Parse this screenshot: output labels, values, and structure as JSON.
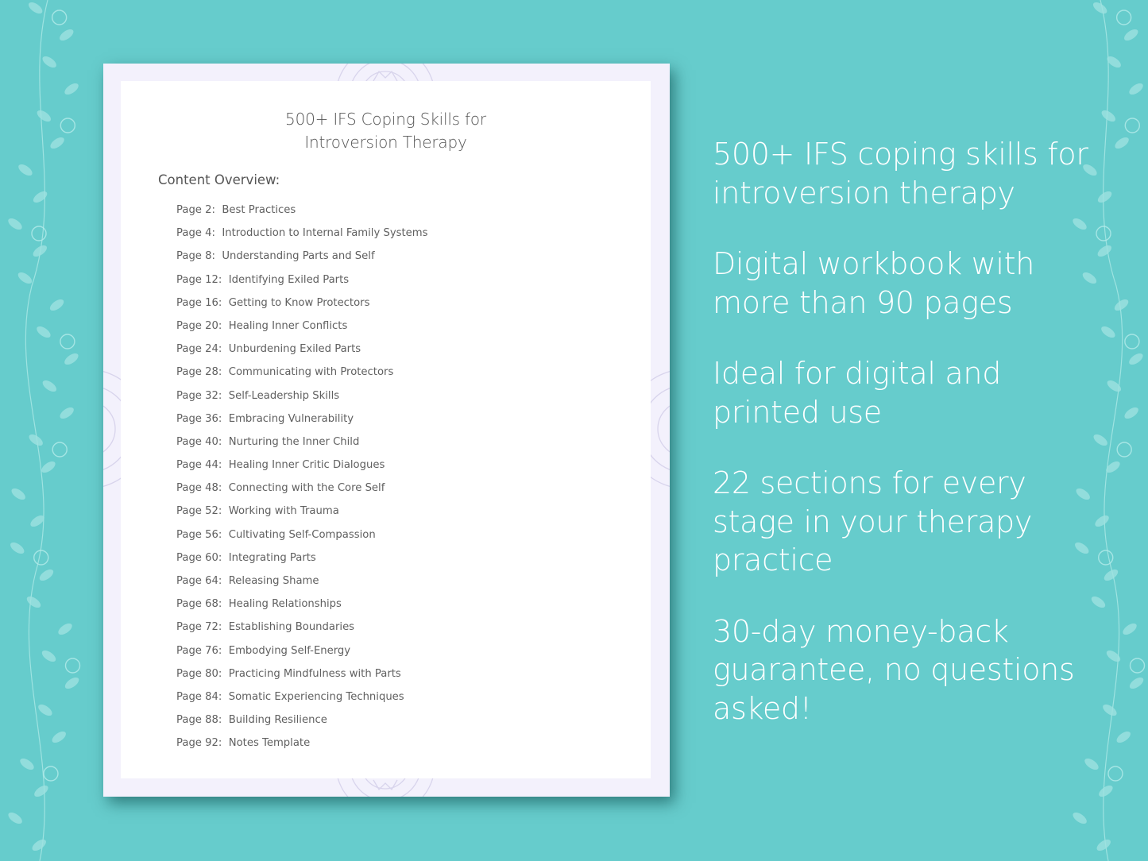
{
  "document": {
    "title_line1": "500+ IFS Coping Skills for",
    "title_line2": "Introversion Therapy",
    "overview_heading": "Content Overview:",
    "toc": [
      {
        "page": "Page  2:",
        "label": "Best Practices"
      },
      {
        "page": "Page  4:",
        "label": "Introduction to Internal Family Systems"
      },
      {
        "page": "Page  8:",
        "label": "Understanding Parts and Self"
      },
      {
        "page": "Page 12:",
        "label": "Identifying Exiled Parts"
      },
      {
        "page": "Page 16:",
        "label": "Getting to Know Protectors"
      },
      {
        "page": "Page 20:",
        "label": "Healing Inner Conflicts"
      },
      {
        "page": "Page 24:",
        "label": "Unburdening Exiled Parts"
      },
      {
        "page": "Page 28:",
        "label": "Communicating with Protectors"
      },
      {
        "page": "Page 32:",
        "label": "Self-Leadership Skills"
      },
      {
        "page": "Page 36:",
        "label": "Embracing Vulnerability"
      },
      {
        "page": "Page 40:",
        "label": "Nurturing the Inner Child"
      },
      {
        "page": "Page 44:",
        "label": "Healing Inner Critic Dialogues"
      },
      {
        "page": "Page 48:",
        "label": "Connecting with the Core Self"
      },
      {
        "page": "Page 52:",
        "label": "Working with Trauma"
      },
      {
        "page": "Page 56:",
        "label": "Cultivating Self-Compassion"
      },
      {
        "page": "Page 60:",
        "label": "Integrating Parts"
      },
      {
        "page": "Page 64:",
        "label": "Releasing Shame"
      },
      {
        "page": "Page 68:",
        "label": "Healing Relationships"
      },
      {
        "page": "Page 72:",
        "label": "Establishing Boundaries"
      },
      {
        "page": "Page 76:",
        "label": "Embodying Self-Energy"
      },
      {
        "page": "Page 80:",
        "label": "Practicing Mindfulness with Parts"
      },
      {
        "page": "Page 84:",
        "label": "Somatic Experiencing Techniques"
      },
      {
        "page": "Page 88:",
        "label": "Building Resilience"
      },
      {
        "page": "Page 92:",
        "label": "Notes Template"
      }
    ]
  },
  "features": [
    "500+ IFS coping skills for introversion therapy",
    "Digital workbook with more than 90 pages",
    "Ideal for digital and printed use",
    "22 sections for every stage in your therapy practice",
    "30-day money-back guarantee, no questions asked!"
  ],
  "colors": {
    "background": "#66cccc",
    "sheet_border": "#f3f1fc",
    "text_dark": "#555555",
    "feature_text": "#ffffff"
  }
}
